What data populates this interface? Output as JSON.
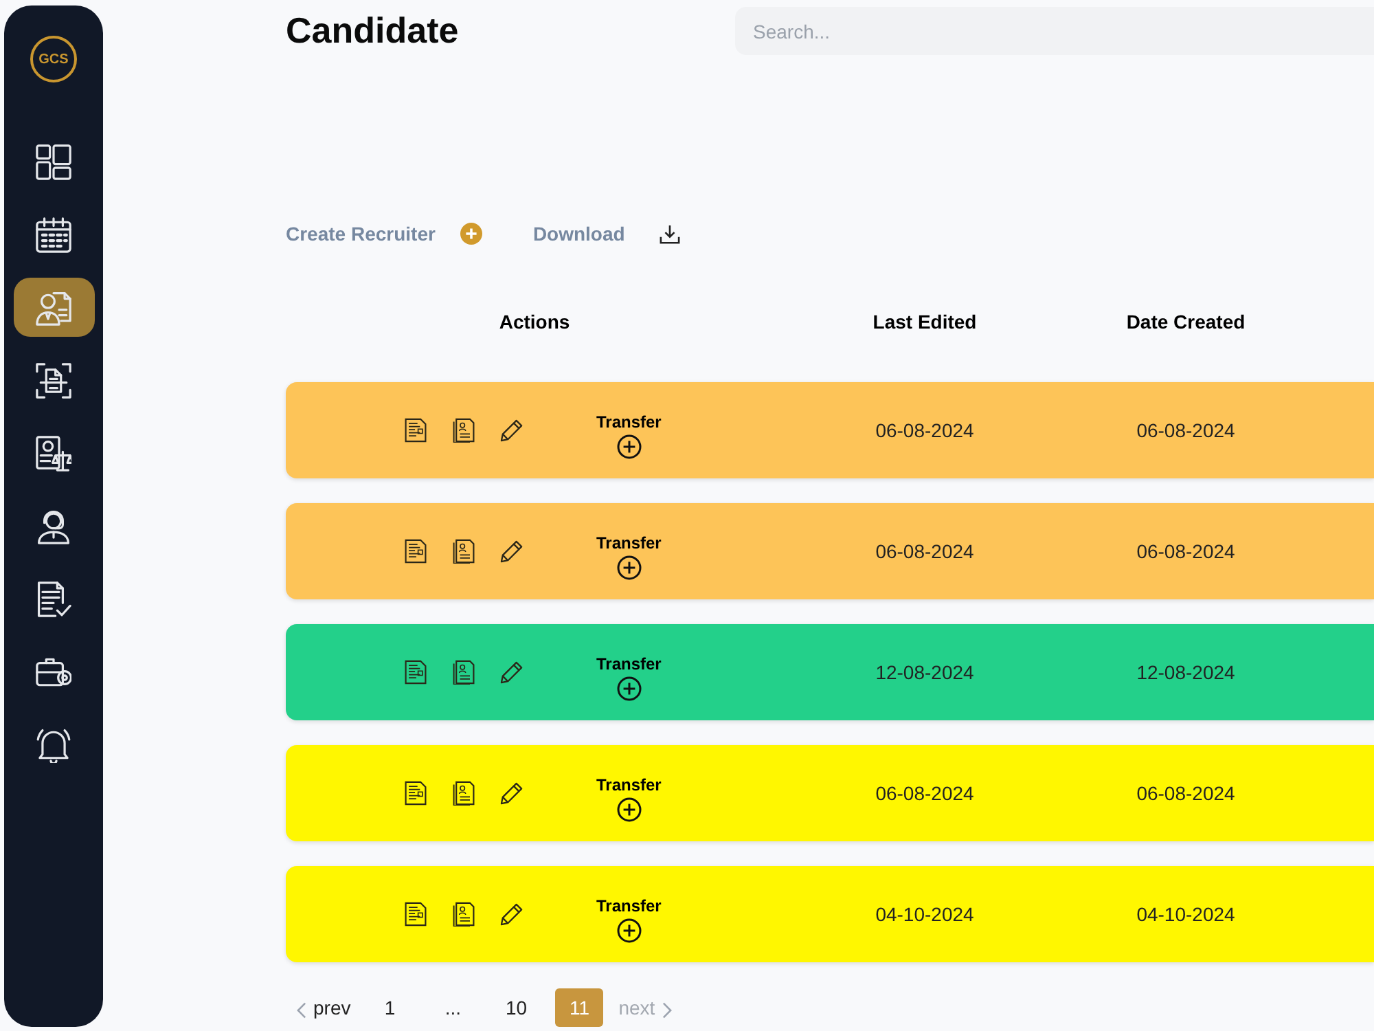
{
  "sidebar": {
    "logo": "GCS",
    "items": [
      {
        "kind": "dashboard",
        "selected": false
      },
      {
        "kind": "calendar",
        "selected": false
      },
      {
        "kind": "candidates",
        "selected": true
      },
      {
        "kind": "scan",
        "selected": false
      },
      {
        "kind": "legal",
        "selected": false
      },
      {
        "kind": "support",
        "selected": false
      },
      {
        "kind": "invoice",
        "selected": false
      },
      {
        "kind": "jobs",
        "selected": false
      },
      {
        "kind": "notifications",
        "selected": false
      }
    ]
  },
  "header": {
    "title": "Candidate",
    "search": {
      "placeholder": "Search..."
    }
  },
  "toolbar": [
    {
      "kind": "create",
      "label": "Create Recruiter"
    },
    {
      "kind": "download",
      "label": "Download"
    }
  ],
  "table": {
    "columns": [
      "Actions",
      "Last Edited",
      "Date Created"
    ],
    "rows": [
      {
        "color": "#fdc458",
        "transfer": "Transfer",
        "last_edited": "06-08-2024",
        "date_created": "06-08-2024"
      },
      {
        "color": "#fdc458",
        "transfer": "Transfer",
        "last_edited": "06-08-2024",
        "date_created": "06-08-2024"
      },
      {
        "color": "#23d08a",
        "transfer": "Transfer",
        "last_edited": "12-08-2024",
        "date_created": "12-08-2024"
      },
      {
        "color": "#fff700",
        "transfer": "Transfer",
        "last_edited": "06-08-2024",
        "date_created": "06-08-2024"
      },
      {
        "color": "#fff700",
        "transfer": "Transfer",
        "last_edited": "04-10-2024",
        "date_created": "04-10-2024"
      }
    ]
  },
  "pagination": [
    {
      "kind": "prev",
      "label": "prev",
      "selected": false,
      "disabled": false
    },
    {
      "kind": "page",
      "label": "1",
      "selected": false,
      "disabled": false
    },
    {
      "kind": "ellipsis",
      "label": "...",
      "selected": false,
      "disabled": false
    },
    {
      "kind": "page",
      "label": "10",
      "selected": false,
      "disabled": false
    },
    {
      "kind": "page",
      "label": "11",
      "selected": true,
      "disabled": false
    },
    {
      "kind": "next",
      "label": "next",
      "selected": false,
      "disabled": true
    }
  ]
}
